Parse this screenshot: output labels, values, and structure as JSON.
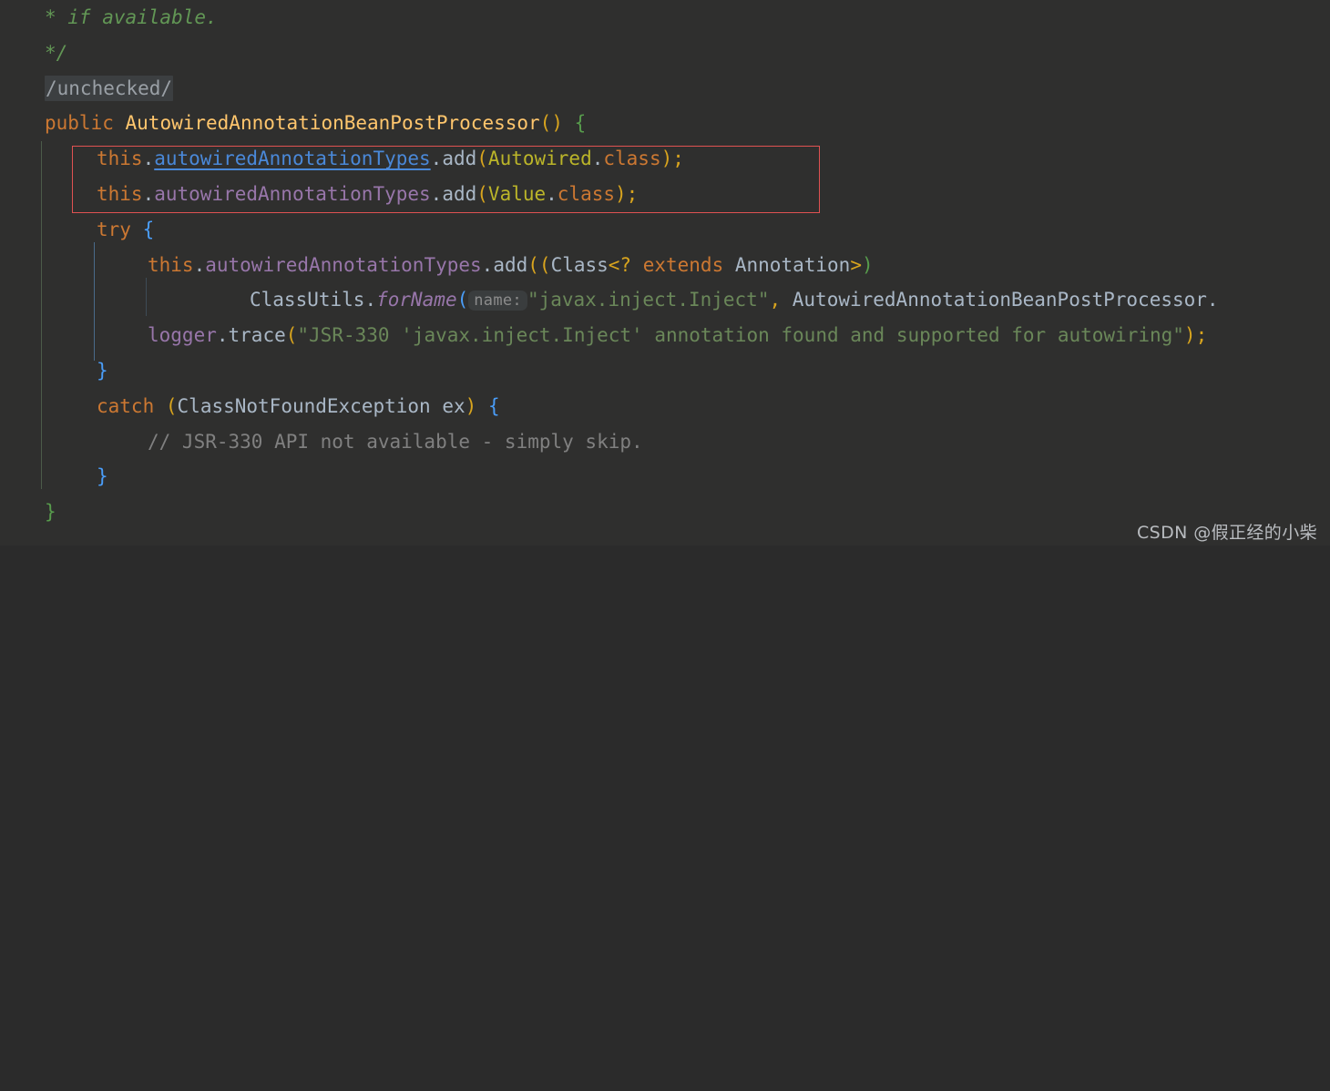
{
  "editor": {
    "background": "#2F2F2E",
    "default_text_color": "#A9B7C6",
    "font_size_px": 21,
    "line_height_px": 38.8,
    "language": "Java",
    "file_context": "AutowiredAnnotationBeanPostProcessor"
  },
  "colors": {
    "keyword": "#CC7832",
    "string": "#6A8759",
    "comment": "#808080",
    "javadoc": "#629755",
    "field": "#9876AA",
    "declaration": "#FFC66D",
    "annotation_value": "#BBB529",
    "brace_matched_green": "#579C4C",
    "brace_blue": "#4A9DF8",
    "paren_yellow": "#D8A41E",
    "hover_link": "#4A88D8",
    "highlight_box": "#E05252",
    "fold_chip_bg": "#3C3F41",
    "param_hint_bg": "#3A3D3E"
  },
  "lines": {
    "l1": {
      "indent": "  ",
      "text": "* if available.",
      "kind": "javadoc"
    },
    "l2": {
      "indent": "  ",
      "text": "*/",
      "kind": "javadoc"
    },
    "l3": {
      "fold_label": "/unchecked/",
      "kind": "folded-region"
    },
    "l4": {
      "keyword": "public",
      "space": " ",
      "name": "AutowiredAnnotationBeanPostProcessor",
      "parens": "()",
      "space2": " ",
      "brace": "{"
    },
    "l5": {
      "this": "this",
      "dot": ".",
      "field": "autowiredAnnotationTypes",
      "dot2": ".",
      "method": "add",
      "open": "(",
      "arg": "Autowired",
      "dot3": ".",
      "classkw": "class",
      "close": ")",
      "semi": ";"
    },
    "l6": {
      "this": "this",
      "dot": ".",
      "field": "autowiredAnnotationTypes",
      "dot2": ".",
      "method": "add",
      "open": "(",
      "arg": "Value",
      "dot3": ".",
      "classkw": "class",
      "close": ")",
      "semi": ";"
    },
    "l7": {
      "keyword": "try",
      "space": " ",
      "brace": "{"
    },
    "l8": {
      "this": "this",
      "dot": ".",
      "field": "autowiredAnnotationTypes",
      "dot2": ".",
      "method": "add",
      "open": "((",
      "type": "Class",
      "lt": "<?",
      "extends": " extends ",
      "type2": "Annotation",
      "gt": ">",
      "close": ")"
    },
    "l9": {
      "cls": "ClassUtils",
      "dot": ".",
      "method": "forName",
      "open": "(",
      "hint": "name:",
      "string": "\"javax.inject.Inject\"",
      "comma": ", ",
      "tail": "AutowiredAnnotationBeanPostProcessor."
    },
    "l10": {
      "logger": "logger",
      "dot": ".",
      "method": "trace",
      "open": "(",
      "string": "\"JSR-330 'javax.inject.Inject' annotation found and supported for autowiring\"",
      "close": ")",
      "semi": ";"
    },
    "l11": {
      "brace": "}"
    },
    "l12": {
      "keyword": "catch",
      "space": " ",
      "open": "(",
      "type": "ClassNotFoundException",
      "space2": " ",
      "var": "ex",
      "close": ")",
      "space3": " ",
      "brace": "{"
    },
    "l13": {
      "comment": "// JSR-330 API not available - simply skip."
    },
    "l14": {
      "brace": "}"
    },
    "l15": {
      "brace": "}"
    }
  },
  "annotations": {
    "highlight_rect": {
      "label": "red-highlight-rectangle",
      "covers_lines": "this.autowiredAnnotationTypes.add(Autowired.class); / this.autowiredAnnotationTypes.add(Value.class);"
    }
  },
  "watermark": {
    "text": "CSDN @假正经的小柴"
  }
}
